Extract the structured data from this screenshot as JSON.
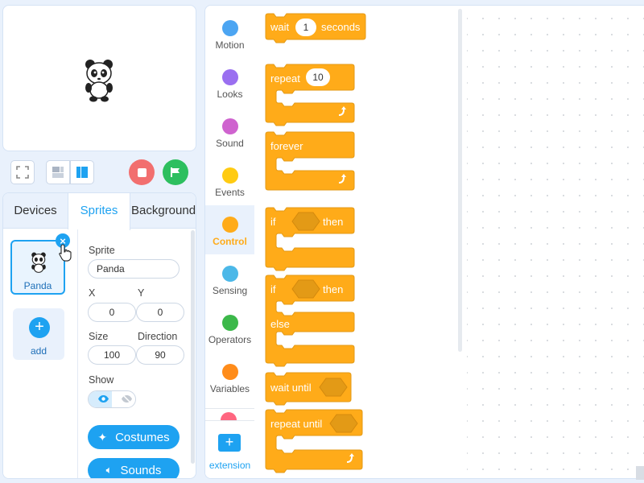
{
  "stage": {
    "sprite_icon": "panda-icon"
  },
  "stage_controls": {
    "fullscreen_icon": "fullscreen-icon",
    "layout_small_icon": "layout-small-icon",
    "layout_large_icon": "layout-large-icon",
    "stop_icon": "stop-icon",
    "go_icon": "green-flag-icon",
    "stop_color": "#f26f6f",
    "go_color": "#2dbf5f"
  },
  "tabs": [
    "Devices",
    "Sprites",
    "Background"
  ],
  "active_tab": "Sprites",
  "sprite_list": {
    "items": [
      {
        "name": "Panda"
      }
    ],
    "add_label": "add"
  },
  "properties": {
    "sprite_label": "Sprite",
    "sprite_name": "Panda",
    "x_label": "X",
    "y_label": "Y",
    "x_value": "0",
    "y_value": "0",
    "size_label": "Size",
    "direction_label": "Direction",
    "size_value": "100",
    "direction_value": "90",
    "show_label": "Show",
    "costumes_label": "Costumes",
    "sounds_label": "Sounds"
  },
  "categories": [
    {
      "label": "Motion",
      "color": "#4ca5f2"
    },
    {
      "label": "Looks",
      "color": "#9a6ff0"
    },
    {
      "label": "Sound",
      "color": "#cf63cf"
    },
    {
      "label": "Events",
      "color": "#ffcb12"
    },
    {
      "label": "Control",
      "color": "#ffab19",
      "active": true
    },
    {
      "label": "Sensing",
      "color": "#4cb8e8"
    },
    {
      "label": "Operators",
      "color": "#3cb84a"
    },
    {
      "label": "Variables",
      "color": "#ff8c1a"
    }
  ],
  "extension_label": "extension",
  "blocks": {
    "color": "#ffab19",
    "wait": {
      "prefix": "wait",
      "value": "1",
      "suffix": "seconds"
    },
    "repeat": {
      "prefix": "repeat",
      "value": "10"
    },
    "forever": {
      "label": "forever"
    },
    "if_then": {
      "if": "if",
      "then": "then"
    },
    "if_else": {
      "if": "if",
      "then": "then",
      "else": "else"
    },
    "wait_until": {
      "label": "wait until"
    },
    "repeat_until": {
      "label": "repeat until"
    }
  }
}
